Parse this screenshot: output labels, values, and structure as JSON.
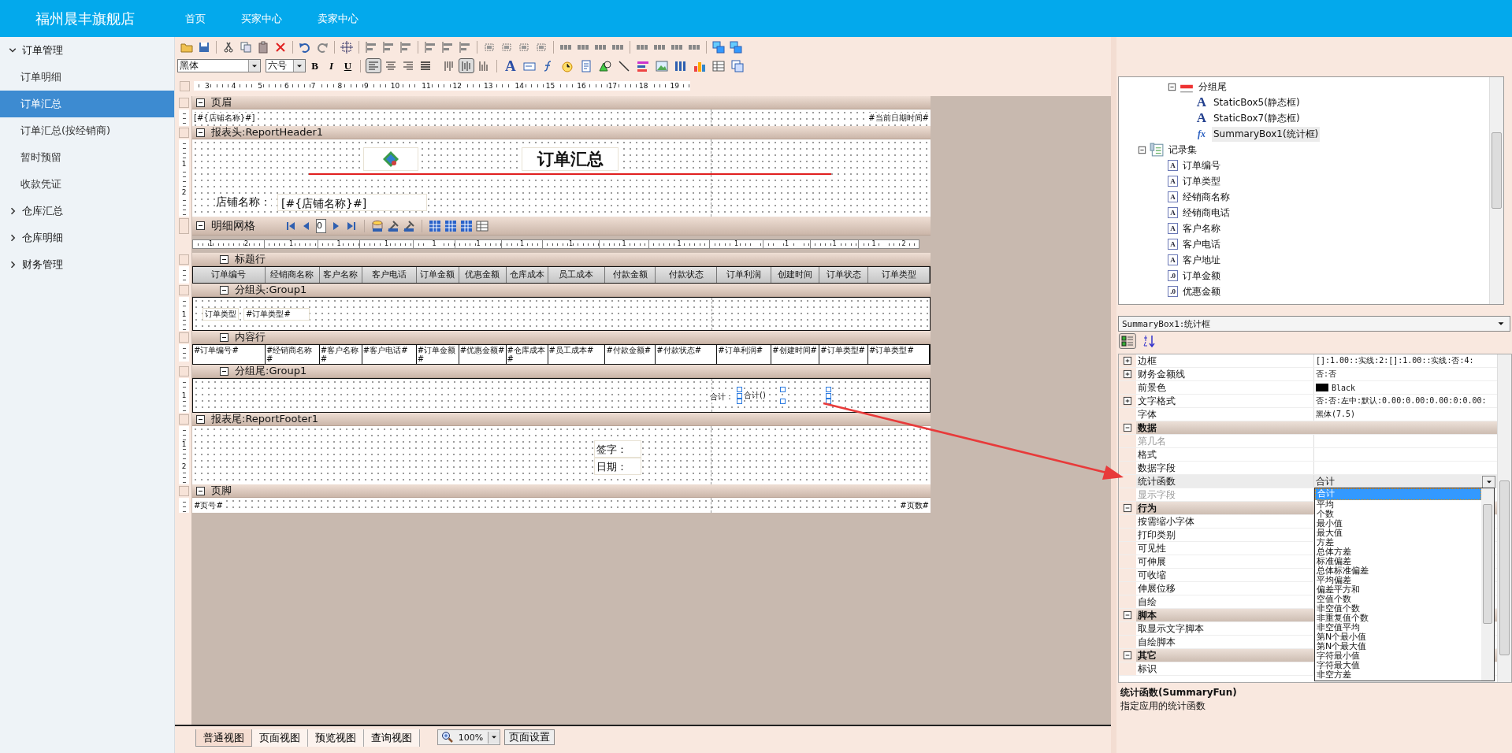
{
  "header": {
    "brand": "福州晨丰旗舰店",
    "nav": [
      {
        "label": "首页"
      },
      {
        "label": "买家中心"
      },
      {
        "label": "卖家中心"
      }
    ]
  },
  "sidebar": [
    {
      "label": "订单管理",
      "expanded": true,
      "children": [
        {
          "label": "订单明细",
          "selected": false
        },
        {
          "label": "订单汇总",
          "selected": true
        },
        {
          "label": "订单汇总(按经销商)",
          "selected": false
        },
        {
          "label": "暂时预留",
          "selected": false
        },
        {
          "label": "收款凭证",
          "selected": false
        }
      ]
    },
    {
      "label": "仓库汇总",
      "expanded": false
    },
    {
      "label": "仓库明细",
      "expanded": false
    },
    {
      "label": "财务管理",
      "expanded": false
    }
  ],
  "format_toolbar": {
    "font": "黑体",
    "size": "六号",
    "bold": "B",
    "italic": "I",
    "underline": "U",
    "text_tool": "A",
    "align_buttons": [
      {
        "kind": "left",
        "selected": true
      },
      {
        "kind": "center",
        "selected": false
      },
      {
        "kind": "right",
        "selected": false
      },
      {
        "kind": "justify",
        "selected": false
      },
      {
        "kind": "top",
        "selected": false
      },
      {
        "kind": "middle",
        "selected": true
      },
      {
        "kind": "bottom",
        "selected": false
      }
    ]
  },
  "ruler": [
    "3",
    "4",
    "5",
    "6",
    "7",
    "8",
    "9",
    "10",
    "11",
    "12",
    "13",
    "14",
    "15",
    "16",
    "17",
    "18",
    "19"
  ],
  "report": {
    "page_header": {
      "label": "页眉",
      "left": "[#{店铺名称}#]",
      "right": "#当前日期时间#"
    },
    "report_header": {
      "label": "报表头:ReportHeader1",
      "title": "订单汇总",
      "shop_label": "店铺名称：",
      "shop_value": "[#{店铺名称}#]",
      "ruler": [
        "1",
        "2"
      ]
    },
    "grid": {
      "label": "明细网格",
      "page": "0",
      "title_band": "标题行",
      "content_band": "内容行",
      "columns": [
        {
          "header": "订单编号",
          "field": "#订单编号#",
          "ruler": "1 2"
        },
        {
          "header": "经销商名称",
          "field": "#经销商名称#",
          "ruler": "1"
        },
        {
          "header": "客户名称",
          "field": "#客户名称#",
          "ruler": "1"
        },
        {
          "header": "客户电话",
          "field": "#客户电话#",
          "ruler": "1"
        },
        {
          "header": "订单金额",
          "field": "#订单金额#",
          "ruler": "1"
        },
        {
          "header": "优惠金额",
          "field": "#优惠金额#",
          "ruler": "1"
        },
        {
          "header": "仓库成本",
          "field": "#仓库成本#",
          "ruler": "1"
        },
        {
          "header": "员工成本",
          "field": "#员工成本#",
          "ruler": "1"
        },
        {
          "header": "付款金额",
          "field": "#付款金额#",
          "ruler": "1"
        },
        {
          "header": "付款状态",
          "field": "#付款状态#",
          "ruler": "1"
        },
        {
          "header": "订单利润",
          "field": "#订单利润#",
          "ruler": "1"
        },
        {
          "header": "创建时间",
          "field": "#创建时间#",
          "ruler": "1"
        },
        {
          "header": "订单状态",
          "field": "#订单类型#",
          "ruler": "1"
        },
        {
          "header": "订单类型",
          "field": "#订单类型#",
          "ruler": "1 2"
        }
      ],
      "group_header": {
        "label": "分组头:Group1",
        "caption": "订单类型",
        "field": "#订单类型#",
        "ruler": [
          "1"
        ]
      },
      "group_footer": {
        "label": "分组尾:Group1",
        "caption": "合计：",
        "summary": "合计()",
        "ruler": [
          "1"
        ]
      }
    },
    "report_footer": {
      "label": "报表尾:ReportFooter1",
      "lines": [
        "签字：",
        "日期："
      ],
      "ruler": [
        "1",
        "2"
      ]
    },
    "page_footer": {
      "label": "页脚",
      "left": "#页号#",
      "right": "#页数#"
    }
  },
  "tree": [
    {
      "label": "分组尾",
      "kind": "band",
      "expanded": true,
      "children": [
        {
          "label": "StaticBox5(静态框)",
          "kind": "static",
          "glyph": "A",
          "selected": false
        },
        {
          "label": "StaticBox7(静态框)",
          "kind": "static",
          "glyph": "A",
          "selected": false
        },
        {
          "label": "SummaryBox1(统计框)",
          "kind": "summary",
          "glyph": "fx",
          "selected": true
        }
      ]
    },
    {
      "label": "记录集",
      "kind": "recordset",
      "expanded": true,
      "children": [
        {
          "label": "订单编号",
          "kind": "field",
          "glyph": "A",
          "selected": false
        },
        {
          "label": "订单类型",
          "kind": "field",
          "glyph": "A",
          "selected": false
        },
        {
          "label": "经销商名称",
          "kind": "field",
          "glyph": "A",
          "selected": false
        },
        {
          "label": "经销商电话",
          "kind": "field",
          "glyph": "A",
          "selected": false
        },
        {
          "label": "客户名称",
          "kind": "field",
          "glyph": "A",
          "selected": false
        },
        {
          "label": "客户电话",
          "kind": "field",
          "glyph": "A",
          "selected": false
        },
        {
          "label": "客户地址",
          "kind": "field",
          "glyph": "A",
          "selected": false
        },
        {
          "label": "订单金额",
          "kind": "field",
          "glyph": ".0",
          "selected": false
        },
        {
          "label": "优惠金额",
          "kind": "field",
          "glyph": ".0",
          "selected": false
        }
      ]
    }
  ],
  "object_selector": "SummaryBox1:统计框",
  "view_buttons": [
    {
      "kind": "categorized",
      "selected": true
    },
    {
      "kind": "alphabetical",
      "selected": false
    }
  ],
  "properties": [
    {
      "kind": "property",
      "name": "边框",
      "value": "[]:1.00::实线:2:[]:1.00::实线:否:4:",
      "expandable": true,
      "disabled": false,
      "selected": false
    },
    {
      "kind": "property",
      "name": "财务金额线",
      "value": "否:否",
      "expandable": true,
      "disabled": false,
      "selected": false
    },
    {
      "kind": "property",
      "name": "前景色",
      "value": "Black",
      "color": "#000000",
      "expandable": false,
      "disabled": false,
      "selected": false
    },
    {
      "kind": "property",
      "name": "文字格式",
      "value": "否:否:左中:默认:0.00:0.00:0.00:0:0.00:",
      "expandable": true,
      "disabled": false,
      "selected": false
    },
    {
      "kind": "property",
      "name": "字体",
      "value": "黑体(7.5)",
      "expandable": false,
      "disabled": false,
      "selected": false
    },
    {
      "kind": "category",
      "name": "数据",
      "expanded": true
    },
    {
      "kind": "property",
      "name": "第几名",
      "expandable": false,
      "disabled": true,
      "selected": false
    },
    {
      "kind": "property",
      "name": "格式",
      "expandable": false,
      "disabled": false,
      "selected": false
    },
    {
      "kind": "property",
      "name": "数据字段",
      "expandable": false,
      "disabled": false,
      "selected": false
    },
    {
      "kind": "property",
      "name": "统计函数",
      "value": "合计",
      "expandable": false,
      "disabled": false,
      "selected": true,
      "open": true,
      "options": [
        {
          "label": "合计",
          "selected": true
        },
        {
          "label": "平均",
          "selected": false
        },
        {
          "label": "个数",
          "selected": false
        },
        {
          "label": "最小值",
          "selected": false
        },
        {
          "label": "最大值",
          "selected": false
        },
        {
          "label": "方差",
          "selected": false
        },
        {
          "label": "总体方差",
          "selected": false
        },
        {
          "label": "标准偏差",
          "selected": false
        },
        {
          "label": "总体标准偏差",
          "selected": false
        },
        {
          "label": "平均偏差",
          "selected": false
        },
        {
          "label": "偏差平方和",
          "selected": false
        },
        {
          "label": "空值个数",
          "selected": false
        },
        {
          "label": "非空值个数",
          "selected": false
        },
        {
          "label": "非重复值个数",
          "selected": false
        },
        {
          "label": "非空值平均",
          "selected": false
        },
        {
          "label": "第N个最小值",
          "selected": false
        },
        {
          "label": "第N个最大值",
          "selected": false
        },
        {
          "label": "字符最小值",
          "selected": false
        },
        {
          "label": "字符最大值",
          "selected": false
        },
        {
          "label": "非空方差",
          "selected": false
        }
      ]
    },
    {
      "kind": "property",
      "name": "显示字段",
      "expandable": false,
      "disabled": true,
      "selected": false
    },
    {
      "kind": "category",
      "name": "行为",
      "expanded": true
    },
    {
      "kind": "property",
      "name": "按需缩小字体",
      "expandable": false,
      "disabled": false,
      "selected": false
    },
    {
      "kind": "property",
      "name": "打印类别",
      "expandable": false,
      "disabled": false,
      "selected": false
    },
    {
      "kind": "property",
      "name": "可见性",
      "expandable": false,
      "disabled": false,
      "selected": false
    },
    {
      "kind": "property",
      "name": "可伸展",
      "expandable": false,
      "disabled": false,
      "selected": false
    },
    {
      "kind": "property",
      "name": "可收缩",
      "expandable": false,
      "disabled": false,
      "selected": false
    },
    {
      "kind": "property",
      "name": "伸展位移",
      "expandable": false,
      "disabled": false,
      "selected": false
    },
    {
      "kind": "property",
      "name": "自绘",
      "expandable": false,
      "disabled": false,
      "selected": false
    },
    {
      "kind": "category",
      "name": "脚本",
      "expanded": true
    },
    {
      "kind": "property",
      "name": "取显示文字脚本",
      "expandable": false,
      "disabled": false,
      "selected": false
    },
    {
      "kind": "property",
      "name": "自绘脚本",
      "expandable": false,
      "disabled": false,
      "selected": false
    },
    {
      "kind": "category",
      "name": "其它",
      "expanded": true
    },
    {
      "kind": "property",
      "name": "标识",
      "expandable": false,
      "disabled": false,
      "selected": false
    }
  ],
  "help": {
    "title": "统计函数(SummaryFun)",
    "text": "指定应用的统计函数"
  },
  "bottom_tabs": [
    {
      "label": "普通视图",
      "selected": true
    },
    {
      "label": "页面视图",
      "selected": false
    },
    {
      "label": "预览视图",
      "selected": false
    },
    {
      "label": "查询视图",
      "selected": false
    }
  ],
  "zoom": "100%",
  "page_setup": "页面设置"
}
